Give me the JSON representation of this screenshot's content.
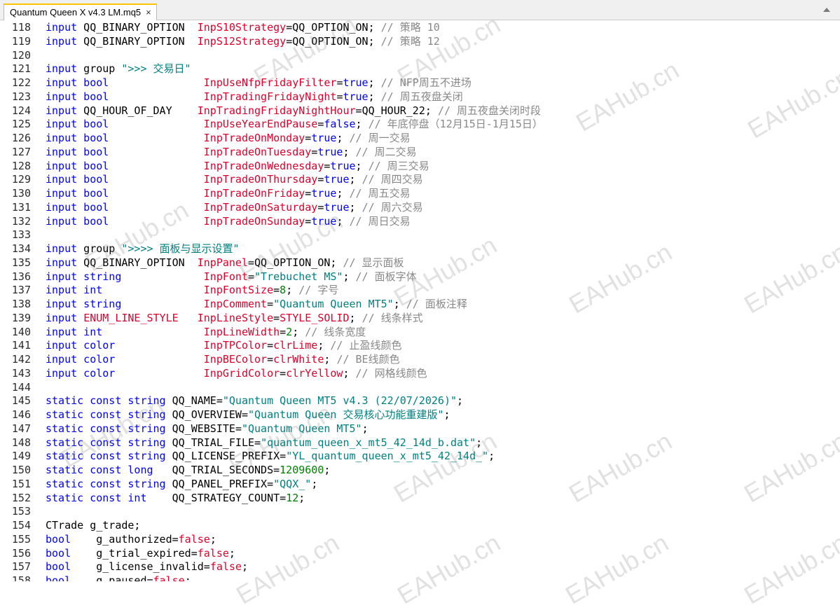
{
  "tab": {
    "title": "Quantum Queen X v4.3 LM.mq5",
    "close_glyph": "×"
  },
  "watermark": "EAHub.cn",
  "colors": {
    "keyword": "#0000ff",
    "variable": "#e0002b",
    "number": "#008000",
    "string": "#008080",
    "comment": "#888888",
    "tab_accent": "#f9c300"
  },
  "lines": [
    {
      "n": "118",
      "tokens": [
        [
          "kw",
          "input"
        ],
        [
          "id",
          " QQ_BINARY_OPTION  "
        ],
        [
          "var",
          "InpS10Strategy"
        ],
        [
          "op",
          "="
        ],
        [
          "id",
          "QQ_OPTION_ON"
        ],
        [
          "op",
          "; "
        ],
        [
          "cm",
          "// 策略 10"
        ]
      ]
    },
    {
      "n": "119",
      "tokens": [
        [
          "kw",
          "input"
        ],
        [
          "id",
          " QQ_BINARY_OPTION  "
        ],
        [
          "var",
          "InpS12Strategy"
        ],
        [
          "op",
          "="
        ],
        [
          "id",
          "QQ_OPTION_ON"
        ],
        [
          "op",
          "; "
        ],
        [
          "cm",
          "// 策略 12"
        ]
      ]
    },
    {
      "n": "120",
      "tokens": []
    },
    {
      "n": "121",
      "tokens": [
        [
          "kw",
          "input"
        ],
        [
          "id",
          " group "
        ],
        [
          "str",
          "\">>> 交易日\""
        ]
      ]
    },
    {
      "n": "122",
      "tokens": [
        [
          "kw",
          "input bool"
        ],
        [
          "id",
          "               "
        ],
        [
          "var",
          "InpUseNfpFridayFilter"
        ],
        [
          "op",
          "="
        ],
        [
          "kw",
          "true"
        ],
        [
          "op",
          "; "
        ],
        [
          "cm",
          "// NFP周五不进场"
        ]
      ]
    },
    {
      "n": "123",
      "tokens": [
        [
          "kw",
          "input bool"
        ],
        [
          "id",
          "               "
        ],
        [
          "var",
          "InpTradingFridayNight"
        ],
        [
          "op",
          "="
        ],
        [
          "kw",
          "true"
        ],
        [
          "op",
          "; "
        ],
        [
          "cm",
          "// 周五夜盘关闭"
        ]
      ]
    },
    {
      "n": "124",
      "tokens": [
        [
          "kw",
          "input"
        ],
        [
          "id",
          " QQ_HOUR_OF_DAY    "
        ],
        [
          "var",
          "InpTradingFridayNightHour"
        ],
        [
          "op",
          "="
        ],
        [
          "id",
          "QQ_HOUR_22"
        ],
        [
          "op",
          "; "
        ],
        [
          "cm",
          "// 周五夜盘关闭时段"
        ]
      ]
    },
    {
      "n": "125",
      "tokens": [
        [
          "kw",
          "input bool"
        ],
        [
          "id",
          "               "
        ],
        [
          "var",
          "InpUseYearEndPause"
        ],
        [
          "op",
          "="
        ],
        [
          "kw",
          "false"
        ],
        [
          "op",
          "; "
        ],
        [
          "cm",
          "// 年底停盘（12月15日-1月15日）"
        ]
      ]
    },
    {
      "n": "126",
      "tokens": [
        [
          "kw",
          "input bool"
        ],
        [
          "id",
          "               "
        ],
        [
          "var",
          "InpTradeOnMonday"
        ],
        [
          "op",
          "="
        ],
        [
          "kw",
          "true"
        ],
        [
          "op",
          "; "
        ],
        [
          "cm",
          "// 周一交易"
        ]
      ]
    },
    {
      "n": "127",
      "tokens": [
        [
          "kw",
          "input bool"
        ],
        [
          "id",
          "               "
        ],
        [
          "var",
          "InpTradeOnTuesday"
        ],
        [
          "op",
          "="
        ],
        [
          "kw",
          "true"
        ],
        [
          "op",
          "; "
        ],
        [
          "cm",
          "// 周二交易"
        ]
      ]
    },
    {
      "n": "128",
      "tokens": [
        [
          "kw",
          "input bool"
        ],
        [
          "id",
          "               "
        ],
        [
          "var",
          "InpTradeOnWednesday"
        ],
        [
          "op",
          "="
        ],
        [
          "kw",
          "true"
        ],
        [
          "op",
          "; "
        ],
        [
          "cm",
          "// 周三交易"
        ]
      ]
    },
    {
      "n": "129",
      "tokens": [
        [
          "kw",
          "input bool"
        ],
        [
          "id",
          "               "
        ],
        [
          "var",
          "InpTradeOnThursday"
        ],
        [
          "op",
          "="
        ],
        [
          "kw",
          "true"
        ],
        [
          "op",
          "; "
        ],
        [
          "cm",
          "// 周四交易"
        ]
      ]
    },
    {
      "n": "130",
      "tokens": [
        [
          "kw",
          "input bool"
        ],
        [
          "id",
          "               "
        ],
        [
          "var",
          "InpTradeOnFriday"
        ],
        [
          "op",
          "="
        ],
        [
          "kw",
          "true"
        ],
        [
          "op",
          "; "
        ],
        [
          "cm",
          "// 周五交易"
        ]
      ]
    },
    {
      "n": "131",
      "tokens": [
        [
          "kw",
          "input bool"
        ],
        [
          "id",
          "               "
        ],
        [
          "var",
          "InpTradeOnSaturday"
        ],
        [
          "op",
          "="
        ],
        [
          "kw",
          "true"
        ],
        [
          "op",
          "; "
        ],
        [
          "cm",
          "// 周六交易"
        ]
      ]
    },
    {
      "n": "132",
      "tokens": [
        [
          "kw",
          "input bool"
        ],
        [
          "id",
          "               "
        ],
        [
          "var",
          "InpTradeOnSunday"
        ],
        [
          "op",
          "="
        ],
        [
          "kw",
          "true"
        ],
        [
          "op",
          "; "
        ],
        [
          "cm",
          "// 周日交易"
        ]
      ]
    },
    {
      "n": "133",
      "tokens": []
    },
    {
      "n": "134",
      "tokens": [
        [
          "kw",
          "input"
        ],
        [
          "id",
          " group "
        ],
        [
          "str",
          "\">>>> 面板与显示设置\""
        ]
      ]
    },
    {
      "n": "135",
      "tokens": [
        [
          "kw",
          "input"
        ],
        [
          "id",
          " QQ_BINARY_OPTION  "
        ],
        [
          "var",
          "InpPanel"
        ],
        [
          "op",
          "="
        ],
        [
          "id",
          "QQ_OPTION_ON"
        ],
        [
          "op",
          "; "
        ],
        [
          "cm",
          "// 显示面板"
        ]
      ]
    },
    {
      "n": "136",
      "tokens": [
        [
          "kw",
          "input string"
        ],
        [
          "id",
          "             "
        ],
        [
          "var",
          "InpFont"
        ],
        [
          "op",
          "="
        ],
        [
          "str",
          "\"Trebuchet MS\""
        ],
        [
          "op",
          "; "
        ],
        [
          "cm",
          "// 面板字体"
        ]
      ]
    },
    {
      "n": "137",
      "tokens": [
        [
          "kw",
          "input int"
        ],
        [
          "id",
          "                "
        ],
        [
          "var",
          "InpFontSize"
        ],
        [
          "op",
          "="
        ],
        [
          "num",
          "8"
        ],
        [
          "op",
          "; "
        ],
        [
          "cm",
          "// 字号"
        ]
      ]
    },
    {
      "n": "138",
      "tokens": [
        [
          "kw",
          "input string"
        ],
        [
          "id",
          "             "
        ],
        [
          "var",
          "InpComment"
        ],
        [
          "op",
          "="
        ],
        [
          "str",
          "\"Quantum Queen MT5\""
        ],
        [
          "op",
          "; "
        ],
        [
          "cm",
          "// 面板注释"
        ]
      ]
    },
    {
      "n": "139",
      "tokens": [
        [
          "kw",
          "input"
        ],
        [
          "id",
          " "
        ],
        [
          "var",
          "ENUM_LINE_STYLE"
        ],
        [
          "id",
          "   "
        ],
        [
          "var",
          "InpLineStyle"
        ],
        [
          "op",
          "="
        ],
        [
          "var",
          "STYLE_SOLID"
        ],
        [
          "op",
          "; "
        ],
        [
          "cm",
          "// 线条样式"
        ]
      ]
    },
    {
      "n": "140",
      "tokens": [
        [
          "kw",
          "input int"
        ],
        [
          "id",
          "                "
        ],
        [
          "var",
          "InpLineWidth"
        ],
        [
          "op",
          "="
        ],
        [
          "num",
          "2"
        ],
        [
          "op",
          "; "
        ],
        [
          "cm",
          "// 线条宽度"
        ]
      ]
    },
    {
      "n": "141",
      "tokens": [
        [
          "kw",
          "input color"
        ],
        [
          "id",
          "              "
        ],
        [
          "var",
          "InpTPColor"
        ],
        [
          "op",
          "="
        ],
        [
          "var",
          "clrLime"
        ],
        [
          "op",
          "; "
        ],
        [
          "cm",
          "// 止盈线颜色"
        ]
      ]
    },
    {
      "n": "142",
      "tokens": [
        [
          "kw",
          "input color"
        ],
        [
          "id",
          "              "
        ],
        [
          "var",
          "InpBEColor"
        ],
        [
          "op",
          "="
        ],
        [
          "var",
          "clrWhite"
        ],
        [
          "op",
          "; "
        ],
        [
          "cm",
          "// BE线颜色"
        ]
      ]
    },
    {
      "n": "143",
      "tokens": [
        [
          "kw",
          "input color"
        ],
        [
          "id",
          "              "
        ],
        [
          "var",
          "InpGridColor"
        ],
        [
          "op",
          "="
        ],
        [
          "var",
          "clrYellow"
        ],
        [
          "op",
          "; "
        ],
        [
          "cm",
          "// 网格线颜色"
        ]
      ]
    },
    {
      "n": "144",
      "tokens": []
    },
    {
      "n": "145",
      "tokens": [
        [
          "kw",
          "static const string"
        ],
        [
          "id",
          " QQ_NAME"
        ],
        [
          "op",
          "="
        ],
        [
          "str",
          "\"Quantum Queen MT5 v4.3 (22/07/2026)\""
        ],
        [
          "op",
          ";"
        ]
      ]
    },
    {
      "n": "146",
      "tokens": [
        [
          "kw",
          "static const string"
        ],
        [
          "id",
          " QQ_OVERVIEW"
        ],
        [
          "op",
          "="
        ],
        [
          "str",
          "\"Quantum Queen 交易核心功能重建版\""
        ],
        [
          "op",
          ";"
        ]
      ]
    },
    {
      "n": "147",
      "tokens": [
        [
          "kw",
          "static const string"
        ],
        [
          "id",
          " QQ_WEBSITE"
        ],
        [
          "op",
          "="
        ],
        [
          "str",
          "\"Quantum Queen MT5\""
        ],
        [
          "op",
          ";"
        ]
      ]
    },
    {
      "n": "148",
      "tokens": [
        [
          "kw",
          "static const string"
        ],
        [
          "id",
          " QQ_TRIAL_FILE"
        ],
        [
          "op",
          "="
        ],
        [
          "str",
          "\"quantum_queen_x_mt5_42_14d_b.dat\""
        ],
        [
          "op",
          ";"
        ]
      ]
    },
    {
      "n": "149",
      "tokens": [
        [
          "kw",
          "static const string"
        ],
        [
          "id",
          " QQ_LICENSE_PREFIX"
        ],
        [
          "op",
          "="
        ],
        [
          "str",
          "\"YL_quantum_queen_x_mt5_42_14d_\""
        ],
        [
          "op",
          ";"
        ]
      ]
    },
    {
      "n": "150",
      "tokens": [
        [
          "kw",
          "static const long"
        ],
        [
          "id",
          "   QQ_TRIAL_SECONDS"
        ],
        [
          "op",
          "="
        ],
        [
          "num",
          "1209600"
        ],
        [
          "op",
          ";"
        ]
      ]
    },
    {
      "n": "151",
      "tokens": [
        [
          "kw",
          "static const string"
        ],
        [
          "id",
          " QQ_PANEL_PREFIX"
        ],
        [
          "op",
          "="
        ],
        [
          "str",
          "\"QQX_\""
        ],
        [
          "op",
          ";"
        ]
      ]
    },
    {
      "n": "152",
      "tokens": [
        [
          "kw",
          "static const int"
        ],
        [
          "id",
          "    QQ_STRATEGY_COUNT"
        ],
        [
          "op",
          "="
        ],
        [
          "num",
          "12"
        ],
        [
          "op",
          ";"
        ]
      ]
    },
    {
      "n": "153",
      "tokens": []
    },
    {
      "n": "154",
      "tokens": [
        [
          "id",
          "CTrade g_trade;"
        ]
      ]
    },
    {
      "n": "155",
      "tokens": [
        [
          "kw",
          "bool"
        ],
        [
          "id",
          "    g_authorized"
        ],
        [
          "op",
          "="
        ],
        [
          "var",
          "false"
        ],
        [
          "op",
          ";"
        ]
      ]
    },
    {
      "n": "156",
      "tokens": [
        [
          "kw",
          "bool"
        ],
        [
          "id",
          "    g_trial_expired"
        ],
        [
          "op",
          "="
        ],
        [
          "var",
          "false"
        ],
        [
          "op",
          ";"
        ]
      ]
    },
    {
      "n": "157",
      "tokens": [
        [
          "kw",
          "bool"
        ],
        [
          "id",
          "    g_license_invalid"
        ],
        [
          "op",
          "="
        ],
        [
          "var",
          "false"
        ],
        [
          "op",
          ";"
        ]
      ]
    },
    {
      "n": "158",
      "tokens": [
        [
          "kw",
          "bool"
        ],
        [
          "id",
          "    g_paused"
        ],
        [
          "op",
          "="
        ],
        [
          "var",
          "false"
        ],
        [
          "op",
          ";"
        ]
      ]
    }
  ]
}
